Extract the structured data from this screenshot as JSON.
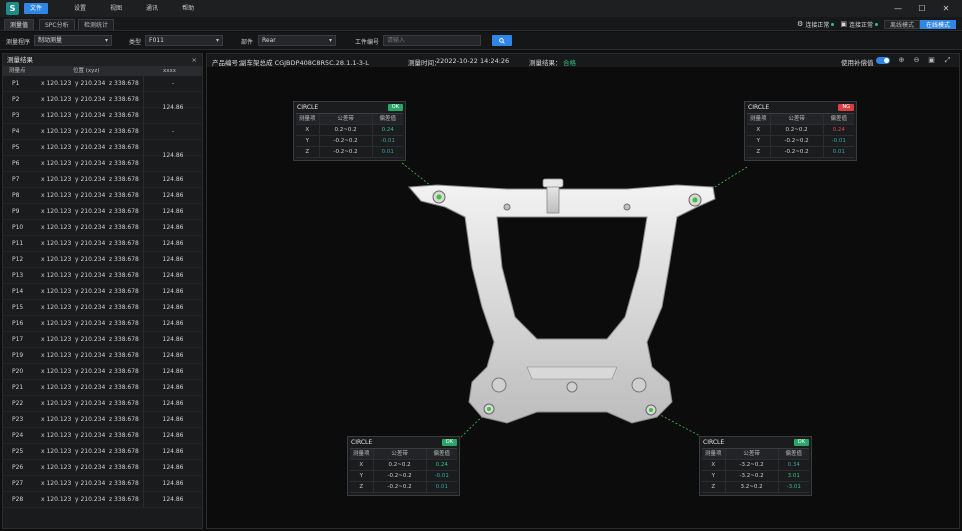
{
  "menu": {
    "logo": "S",
    "items": [
      "文件",
      "设置",
      "视图",
      "通讯",
      "帮助"
    ]
  },
  "tabs": [
    "测量值",
    "SPC分析",
    "检测统计"
  ],
  "status": {
    "conn1": "连接正常",
    "conn2": "连接正常",
    "mode1": "离线模式",
    "mode2": "在线模式"
  },
  "filters": {
    "label_program": "测量程序",
    "program": "制动测量",
    "label_type": "类型",
    "type": "F011",
    "label_side": "部件",
    "side": "Rear",
    "label_serial": "工件编号",
    "serial_placeholder": "请输入"
  },
  "left_panel": {
    "title": "测量结果",
    "col_point": "测量点",
    "col_pos": "位置 (xyz)",
    "col_val": "xxxx",
    "rows": [
      {
        "p": "P1",
        "x": "x 120.123",
        "y": "y 210.234",
        "z": "z 338.678"
      },
      {
        "p": "P2",
        "x": "x 120.123",
        "y": "y 210.234",
        "z": "z 338.678"
      },
      {
        "p": "P3",
        "x": "x 120.123",
        "y": "y 210.234",
        "z": "z 338.678"
      },
      {
        "p": "P4",
        "x": "x 120.123",
        "y": "y 210.234",
        "z": "z 338.678"
      },
      {
        "p": "P5",
        "x": "x 120.123",
        "y": "y 210.234",
        "z": "z 338.678"
      },
      {
        "p": "P6",
        "x": "x 120.123",
        "y": "y 210.234",
        "z": "z 338.678"
      },
      {
        "p": "P7",
        "x": "x 120.123",
        "y": "y 210.234",
        "z": "z 338.678"
      },
      {
        "p": "P8",
        "x": "x 120.123",
        "y": "y 210.234",
        "z": "z 338.678"
      },
      {
        "p": "P9",
        "x": "x 120.123",
        "y": "y 210.234",
        "z": "z 338.678"
      },
      {
        "p": "P10",
        "x": "x 120.123",
        "y": "y 210.234",
        "z": "z 338.678"
      },
      {
        "p": "P11",
        "x": "x 120.123",
        "y": "y 210.234",
        "z": "z 338.678"
      },
      {
        "p": "P12",
        "x": "x 120.123",
        "y": "y 210.234",
        "z": "z 338.678"
      },
      {
        "p": "P13",
        "x": "x 120.123",
        "y": "y 210.234",
        "z": "z 338.678"
      },
      {
        "p": "P14",
        "x": "x 120.123",
        "y": "y 210.234",
        "z": "z 338.678"
      },
      {
        "p": "P15",
        "x": "x 120.123",
        "y": "y 210.234",
        "z": "z 338.678"
      },
      {
        "p": "P16",
        "x": "x 120.123",
        "y": "y 210.234",
        "z": "z 338.678"
      },
      {
        "p": "P17",
        "x": "x 120.123",
        "y": "y 210.234",
        "z": "z 338.678"
      },
      {
        "p": "P19",
        "x": "x 120.123",
        "y": "y 210.234",
        "z": "z 338.678"
      },
      {
        "p": "P20",
        "x": "x 120.123",
        "y": "y 210.234",
        "z": "z 338.678"
      },
      {
        "p": "P21",
        "x": "x 120.123",
        "y": "y 210.234",
        "z": "z 338.678"
      },
      {
        "p": "P22",
        "x": "x 120.123",
        "y": "y 210.234",
        "z": "z 338.678"
      },
      {
        "p": "P23",
        "x": "x 120.123",
        "y": "y 210.234",
        "z": "z 338.678"
      },
      {
        "p": "P24",
        "x": "x 120.123",
        "y": "y 210.234",
        "z": "z 338.678"
      },
      {
        "p": "P25",
        "x": "x 120.123",
        "y": "y 210.234",
        "z": "z 338.678"
      },
      {
        "p": "P26",
        "x": "x 120.123",
        "y": "y 210.234",
        "z": "z 338.678"
      },
      {
        "p": "P27",
        "x": "x 120.123",
        "y": "y 210.234",
        "z": "z 338.678"
      },
      {
        "p": "P28",
        "x": "x 120.123",
        "y": "y 210.234",
        "z": "z 338.678"
      }
    ],
    "merged_values": [
      "-",
      "124.86",
      "-",
      "124.86",
      "124.86",
      "124.86",
      "124.86",
      "124.86",
      "124.86",
      "124.86",
      "124.86",
      "124.86",
      "124.86",
      "124.86",
      "124.86",
      "124.86",
      "124.86",
      "124.86",
      "124.86",
      "124.86",
      "124.86",
      "124.86",
      "124.86",
      "124.86",
      "124.86"
    ]
  },
  "main": {
    "product_label": "产品编号：",
    "product": "副车架总成 CGJBDP408C8R5C.28.1.1-3-L",
    "time_label": "测量时间：",
    "time": "22022-10-22  14:24:26",
    "result_label": "测量结果：",
    "result": "合格",
    "toggle_label": "使用补偿值"
  },
  "cards": [
    {
      "title": "CIRCLE",
      "badge": "OK",
      "status": "ok",
      "head": [
        "测量项",
        "公差带",
        "偏差值"
      ],
      "rows": [
        [
          "X",
          "0.2~0.2",
          "0.24",
          "ok"
        ],
        [
          "Y",
          "-0.2~0.2",
          "-0.01",
          "mut"
        ],
        [
          "Z",
          "-0.2~0.2",
          "0.01",
          "mut"
        ]
      ]
    },
    {
      "title": "CIRCLE",
      "badge": "NG",
      "status": "ng",
      "head": [
        "测量项",
        "公差带",
        "偏差值"
      ],
      "rows": [
        [
          "X",
          "0.2~0.2",
          "0.24",
          "ng"
        ],
        [
          "Y",
          "-0.2~0.2",
          "-0.01",
          "mut"
        ],
        [
          "Z",
          "-0.2~0.2",
          "0.01",
          "mut"
        ]
      ]
    },
    {
      "title": "CIRCLE",
      "badge": "OK",
      "status": "ok",
      "head": [
        "测量项",
        "公差带",
        "偏差值"
      ],
      "rows": [
        [
          "X",
          "0.2~0.2",
          "0.24",
          "ok"
        ],
        [
          "Y",
          "-0.2~0.2",
          "-0.01",
          "mut"
        ],
        [
          "Z",
          "-0.2~0.2",
          "0.01",
          "mut"
        ]
      ]
    },
    {
      "title": "CIRCLE",
      "badge": "OK",
      "status": "ok",
      "head": [
        "测量项",
        "公差带",
        "偏差值"
      ],
      "rows": [
        [
          "X",
          "-3.2~0.2",
          "0.34",
          "mut"
        ],
        [
          "Y",
          "-3.2~0.2",
          "3.01",
          "ok"
        ],
        [
          "Z",
          "3.2~0.2",
          "-3.01",
          "ok"
        ]
      ]
    }
  ]
}
